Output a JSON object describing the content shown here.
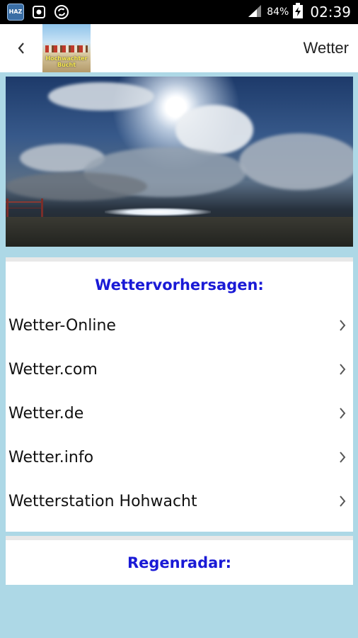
{
  "status_bar": {
    "app_icon_text": "HAZ",
    "battery_percent": "84%",
    "time": "02:39"
  },
  "action_bar": {
    "logo_text_line1": "Hochwachter",
    "logo_text_line2": "Bucht",
    "title": "Wetter"
  },
  "forecast": {
    "heading": "Wettervorhersagen:",
    "items": [
      {
        "label": "Wetter-Online"
      },
      {
        "label": "Wetter.com"
      },
      {
        "label": "Wetter.de"
      },
      {
        "label": "Wetter.info"
      },
      {
        "label": "Wetterstation Hohwacht"
      }
    ]
  },
  "radar": {
    "heading": "Regenradar:"
  },
  "colors": {
    "background": "#add8e6",
    "heading_blue": "#1a1ad6"
  }
}
